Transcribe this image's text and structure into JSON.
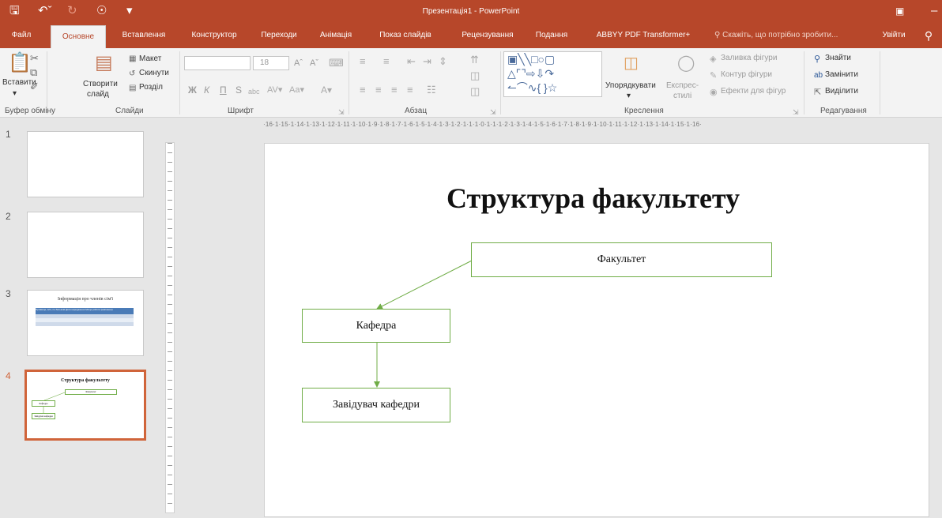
{
  "window": {
    "title": "Презентація1 - PowerPoint"
  },
  "tabs": [
    "Файл",
    "Основне",
    "Вставлення",
    "Конструктор",
    "Переходи",
    "Анімація",
    "Показ слайдів",
    "Рецензування",
    "Подання",
    "ABBYY PDF Transformer+"
  ],
  "search": {
    "placeholder": "Скажіть, що потрібно зробити..."
  },
  "account": {
    "signin": "Увійти"
  },
  "ribbon": {
    "clipboard": {
      "paste": "Вставити",
      "label": "Буфер обміну"
    },
    "slides": {
      "new_slide_1": "Створити",
      "new_slide_2": "слайд",
      "layout": "Макет",
      "reset": "Скинути",
      "section": "Розділ",
      "label": "Слайди"
    },
    "font": {
      "size": "18",
      "bold": "Ж",
      "italic": "К",
      "underline": "П",
      "strike": "S",
      "label": "Шрифт"
    },
    "paragraph": {
      "label": "Абзац"
    },
    "drawing": {
      "arrange": "Упорядкувати",
      "styles_1": "Експрес-",
      "styles_2": "стилі",
      "fill": "Заливка фігури",
      "outline": "Контур фігури",
      "effects": "Ефекти для фігур",
      "label": "Креслення"
    },
    "editing": {
      "find": "Знайти",
      "replace": "Замінити",
      "select": "Виділити",
      "label": "Редагування"
    }
  },
  "ruler": {
    "top": "·16·1·15·1·14·1·13·1·12·1·11·1·10·1·9·1·8·1·7·1·6·1·5·1·4·1·3·1·2·1·1·1·0·1·1·1·2·1·3·1·4·1·5·1·6·1·7·1·8·1·9·1·10·1·11·1·12·1·13·1·14·1·15·1·16·"
  },
  "thumbnails": [
    {
      "number": "1"
    },
    {
      "number": "2"
    },
    {
      "number": "3",
      "title": "Інформація про членів сім'ї",
      "headers": [
        "Прізвище, ім'я, по батькові",
        "Дата народження",
        "Місце роботи (навчання)"
      ]
    },
    {
      "number": "4",
      "title": "Структура факультету",
      "boxes": [
        "Факультет",
        "Кафедра",
        "Завідувач кафедри"
      ]
    }
  ],
  "slide": {
    "title": "Структура факультету",
    "nodes": [
      "Факультет",
      "Кафедра",
      "Завідувач кафедри"
    ]
  },
  "colors": {
    "accent": "#b7472a",
    "shape_border": "#70ad47",
    "selection": "#d0643a"
  }
}
